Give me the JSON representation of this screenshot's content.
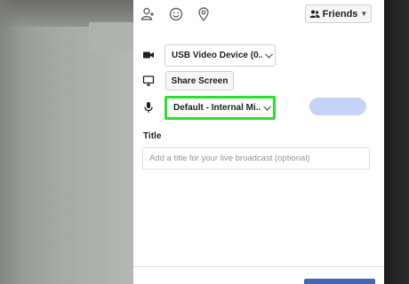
{
  "toolbar": {
    "icons": [
      "tag-people-icon",
      "feeling-emoji-icon",
      "location-pin-icon"
    ],
    "audience_label": "Friends"
  },
  "devices": {
    "camera_value": "USB Video Device (0...",
    "share_screen_label": "Share Screen",
    "microphone_value": "Default - Internal Mi..."
  },
  "title_section": {
    "label": "Title",
    "placeholder": "Add a title for your live broadcast (optional)"
  },
  "colors": {
    "highlight": "#2be12b",
    "accent": "#4267b2",
    "pill": "#c3d4f6"
  }
}
